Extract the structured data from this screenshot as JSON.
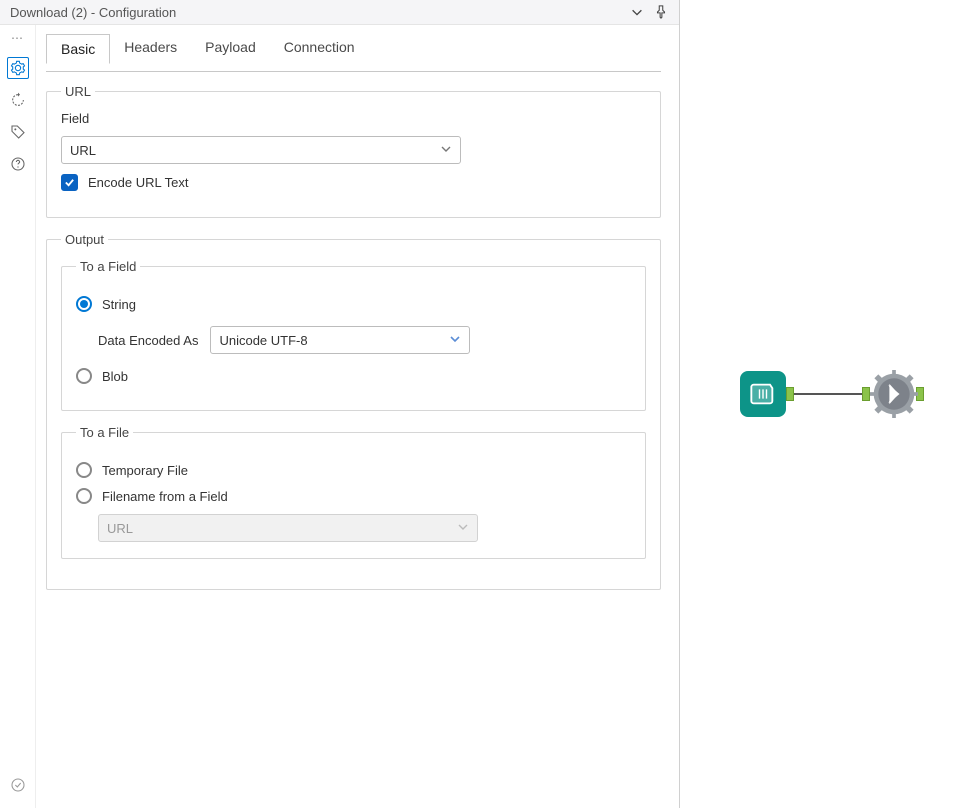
{
  "titlebar": {
    "title": "Download (2) - Configuration"
  },
  "tabs": {
    "basic": "Basic",
    "headers": "Headers",
    "payload": "Payload",
    "connection": "Connection"
  },
  "url_group": {
    "legend": "URL",
    "field_label": "Field",
    "selected": "URL",
    "encode_label": "Encode URL Text"
  },
  "output_group": {
    "legend": "Output",
    "to_field": {
      "legend": "To a Field",
      "string_label": "String",
      "encoded_label": "Data Encoded As",
      "encoded_value": "Unicode UTF-8",
      "blob_label": "Blob"
    },
    "to_file": {
      "legend": "To a File",
      "temp_label": "Temporary File",
      "filename_label": "Filename from a Field",
      "filename_value": "URL"
    }
  }
}
